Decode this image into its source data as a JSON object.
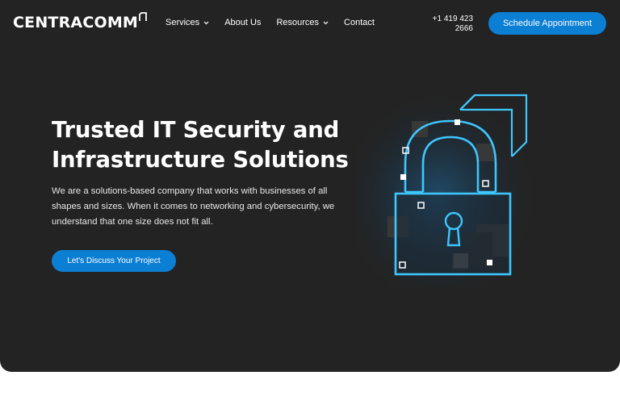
{
  "brand": {
    "logo_text": "CENTRACOMM"
  },
  "nav": {
    "items": [
      {
        "label": "Services",
        "has_dropdown": true
      },
      {
        "label": "About Us",
        "has_dropdown": false
      },
      {
        "label": "Resources",
        "has_dropdown": true
      },
      {
        "label": "Contact",
        "has_dropdown": false
      }
    ]
  },
  "header": {
    "phone": "+1 419 423 2666",
    "schedule_label": "Schedule Appointment"
  },
  "hero": {
    "title_line1": "Trusted IT Security and",
    "title_line2": "Infrastructure Solutions",
    "description": "We are a solutions-based company that works with businesses of all shapes and sizes. When it comes to networking and cybersecurity, we understand that one size does not fit all.",
    "cta_label": "Let's Discuss Your Project",
    "illustration_icon": "padlock-icon"
  },
  "colors": {
    "hero_background": "#232323",
    "accent_blue": "#0b7fd4",
    "lock_glow": "#3ec6ff"
  }
}
